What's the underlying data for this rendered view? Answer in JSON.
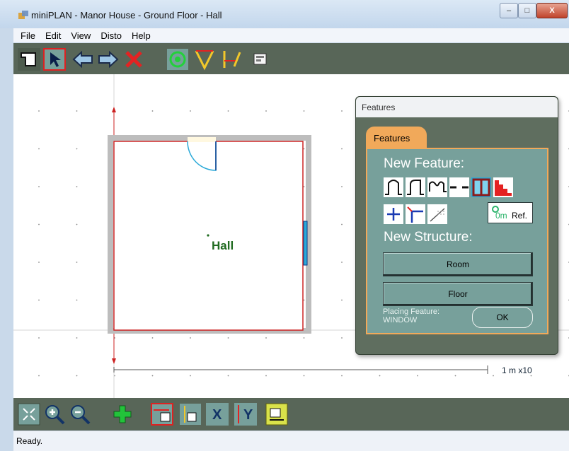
{
  "window": {
    "title": "miniPLAN - Manor House - Ground Floor - Hall",
    "controls": {
      "minimize": "–",
      "maximize": "□",
      "close": "X"
    }
  },
  "menu": [
    "File",
    "Edit",
    "View",
    "Disto",
    "Help"
  ],
  "toolbar": {
    "tools": [
      "new-room-tool",
      "select-arrow-tool",
      "back-arrow-tool",
      "forward-arrow-tool",
      "delete-tool",
      "record-tool",
      "corner-angle-tool",
      "wall-offset-tool",
      "properties-tool"
    ],
    "active": "select-arrow-tool"
  },
  "plan": {
    "room_label": "Hall",
    "scale_label": "1 m x10",
    "accent_colors": {
      "wall": "#cc2222",
      "door": "#2aa9d8",
      "room_label": "#1f6a1f"
    }
  },
  "features_dialog": {
    "title": "Features",
    "tab_label": "Features",
    "new_feature_heading": "New Feature:",
    "feature_icons": [
      "door-outward-icon",
      "door-inward-icon",
      "opening-arch-icon",
      "dashed-line-icon",
      "window-icon",
      "stairs-icon",
      "cross-point-icon",
      "corner-icon",
      "dimension-line-icon",
      "reference-point-icon"
    ],
    "ref_label": "Ref.",
    "ref_value": "0m",
    "new_structure_heading": "New Structure:",
    "room_button": "Room",
    "floor_button": "Floor",
    "placing_label": "Placing Feature:",
    "placing_value": "WINDOW",
    "ok_button": "OK"
  },
  "bottom_toolbar": {
    "tools": [
      "fit-view-tool",
      "zoom-in-tool",
      "zoom-out-tool",
      "add-tool",
      "horizontal-measure-tool",
      "vertical-measure-tool",
      "x-axis-tool",
      "y-axis-tool",
      "disto-device-tool"
    ],
    "labels": {
      "x": "X",
      "y": "Y"
    }
  },
  "status": {
    "text": "Ready."
  }
}
